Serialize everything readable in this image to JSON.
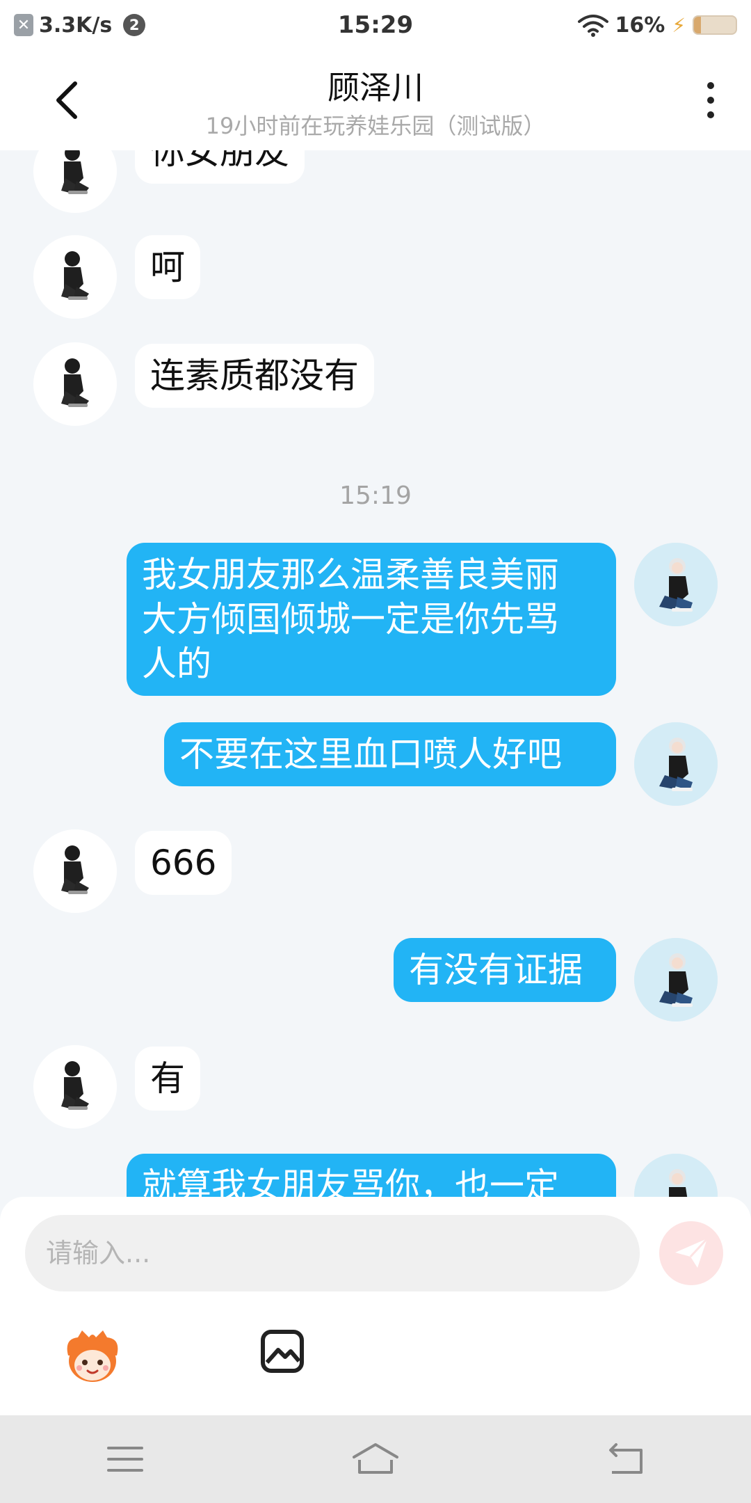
{
  "status_bar": {
    "speed": "3.3K/s",
    "notif_count": "2",
    "time": "15:29",
    "battery": "16%",
    "battery_level": 0.16
  },
  "header": {
    "title": "顾泽川",
    "subtitle": "19小时前在玩养娃乐园（测试版）"
  },
  "messages": [
    {
      "side": "in",
      "text": "你女朋友"
    },
    {
      "side": "in",
      "text": "呵"
    },
    {
      "side": "in",
      "text": "连素质都没有"
    },
    {
      "type": "time",
      "text": "15:19"
    },
    {
      "side": "out",
      "text": "我女朋友那么温柔善良美丽\n大方倾国倾城一定是你先骂\n人的"
    },
    {
      "side": "out",
      "text": "不要在这里血口喷人好吧"
    },
    {
      "side": "in",
      "text": "666"
    },
    {
      "side": "out",
      "text": "有没有证据"
    },
    {
      "side": "in",
      "text": "有"
    },
    {
      "side": "out",
      "text": "就算我女朋友骂你，也一定"
    }
  ],
  "input": {
    "placeholder": "请输入..."
  },
  "icons": {
    "back": "chevron-left-icon",
    "more": "more-vertical-icon",
    "send": "send-icon",
    "emoji": "mascot-emoji-icon",
    "image": "image-icon",
    "menu": "menu-icon",
    "home": "home-icon",
    "return": "return-icon"
  },
  "colors": {
    "outgoing_bubble": "#22b4f5",
    "incoming_bubble": "#ffffff",
    "chat_background": "#f3f6f9",
    "send_button": "#fde3e3"
  }
}
